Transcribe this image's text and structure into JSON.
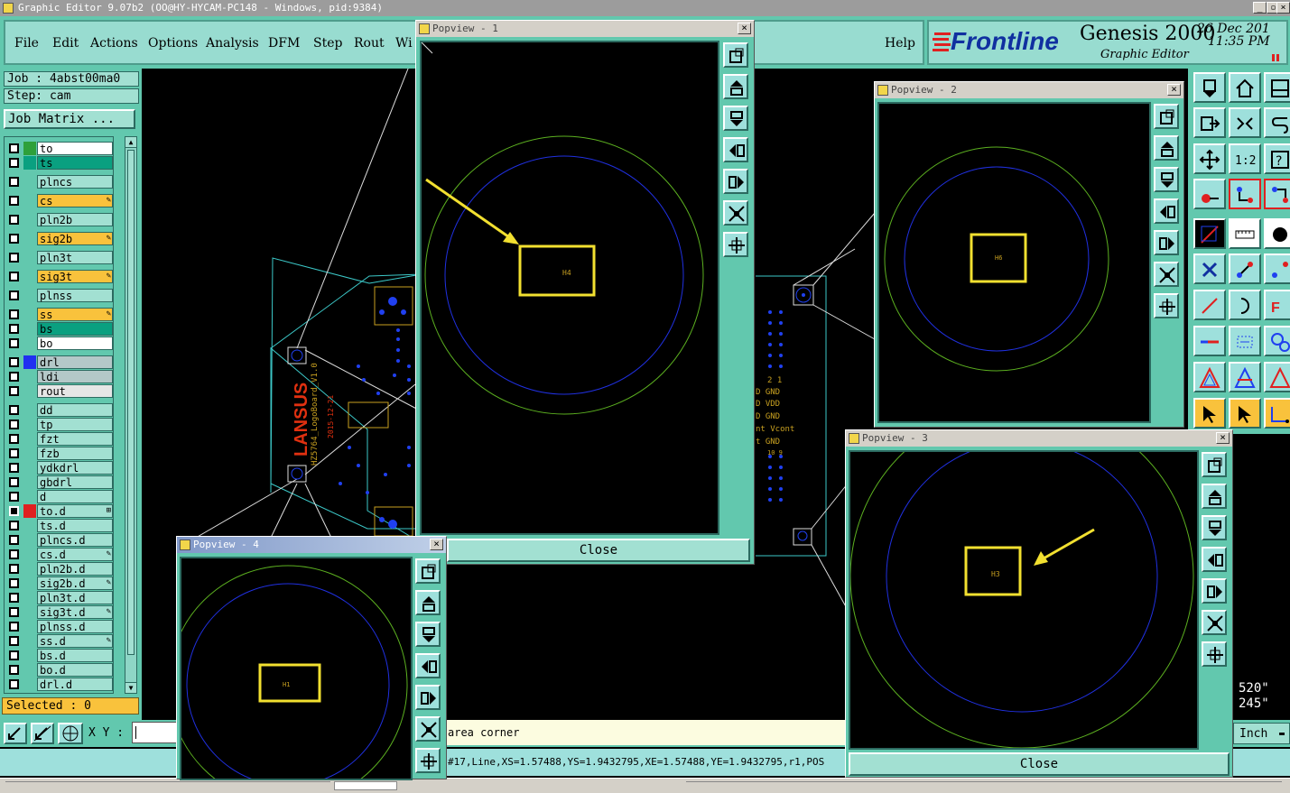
{
  "window": {
    "title": "Graphic Editor 9.07b2 (OO@HY-HYCAM-PC148 - Windows, pid:9384)"
  },
  "menu": {
    "items": [
      "File",
      "Edit",
      "Actions",
      "Options",
      "Analysis",
      "DFM",
      "Step",
      "Rout",
      "Wi"
    ],
    "help": "Help"
  },
  "brand": {
    "logo": "Frontline",
    "product": "Genesis 2000",
    "subtitle": "Graphic Editor",
    "date": "26 Dec 201",
    "time": "11:35 PM"
  },
  "job": {
    "job_label": "Job : 4abst00ma0",
    "step_label": "Step: cam",
    "matrix_button": "Job Matrix ..."
  },
  "layers": [
    {
      "name": "to",
      "bg": "#ffffff",
      "swatch": "#2ea03a"
    },
    {
      "name": "ts",
      "bg": "#0aa080",
      "swatch": "#0aa080"
    },
    {
      "name": "plncs",
      "bg": "#a2e0d2"
    },
    {
      "name": "cs",
      "bg": "#f9c23c",
      "edit": true
    },
    {
      "name": "pln2b",
      "bg": "#a2e0d2"
    },
    {
      "name": "sig2b",
      "bg": "#f9c23c",
      "edit": true
    },
    {
      "name": "pln3t",
      "bg": "#a2e0d2"
    },
    {
      "name": "sig3t",
      "bg": "#f9c23c",
      "edit": true
    },
    {
      "name": "plnss",
      "bg": "#a2e0d2"
    },
    {
      "name": "ss",
      "bg": "#f9c23c",
      "edit": true
    },
    {
      "name": "bs",
      "bg": "#0aa080"
    },
    {
      "name": "bo",
      "bg": "#ffffff"
    },
    {
      "name": "drl",
      "bg": "#b4c8c8",
      "swatch": "#2030f0"
    },
    {
      "name": "ldi",
      "bg": "#b4c8c8"
    },
    {
      "name": "rout",
      "bg": "#e6e6e6"
    },
    {
      "name": "dd",
      "bg": "#a2e0d2"
    },
    {
      "name": "tp",
      "bg": "#a2e0d2"
    },
    {
      "name": "fzt",
      "bg": "#a2e0d2"
    },
    {
      "name": "fzb",
      "bg": "#a2e0d2"
    },
    {
      "name": "ydkdrl",
      "bg": "#a2e0d2"
    },
    {
      "name": "gbdrl",
      "bg": "#a2e0d2"
    },
    {
      "name": "d",
      "bg": "#a2e0d2"
    },
    {
      "name": "to.d",
      "bg": "#a2e0d2",
      "swatch": "#e02020",
      "active": true,
      "grid": true
    },
    {
      "name": "ts.d",
      "bg": "#a2e0d2"
    },
    {
      "name": "plncs.d",
      "bg": "#a2e0d2"
    },
    {
      "name": "cs.d",
      "bg": "#a2e0d2",
      "edit": true
    },
    {
      "name": "pln2b.d",
      "bg": "#a2e0d2"
    },
    {
      "name": "sig2b.d",
      "bg": "#a2e0d2",
      "edit": true
    },
    {
      "name": "pln3t.d",
      "bg": "#a2e0d2"
    },
    {
      "name": "sig3t.d",
      "bg": "#a2e0d2",
      "edit": true
    },
    {
      "name": "plnss.d",
      "bg": "#a2e0d2"
    },
    {
      "name": "ss.d",
      "bg": "#a2e0d2",
      "edit": true
    },
    {
      "name": "bs.d",
      "bg": "#a2e0d2"
    },
    {
      "name": "bo.d",
      "bg": "#a2e0d2"
    },
    {
      "name": "drl.d",
      "bg": "#a2e0d2"
    }
  ],
  "selected": "Selected : 0",
  "bottom": {
    "xy_label": "X Y :",
    "message": "area corner",
    "status": "#17,Line,XS=1.57488,YS=1.9432795,XE=1.57488,YE=1.9432795,r1,POS",
    "units": "Inch",
    "coord1": "520\"",
    "coord2": "245\""
  },
  "board": {
    "brand": "LANSUS",
    "board_name": "HZ5764_LogoBoard_V1.0",
    "board_date": "2015-12-21",
    "header_cols": "2   1",
    "pins": [
      "D   GND",
      "D   VDD",
      "D   GND",
      "nt  Vcont",
      "t   GND",
      "10  9"
    ]
  },
  "popups": [
    {
      "id": "1",
      "title": "Popview - 1",
      "label": "H4",
      "close": "Close"
    },
    {
      "id": "2",
      "title": "Popview - 2",
      "label": "H6"
    },
    {
      "id": "3",
      "title": "Popview - 3",
      "label": "H3",
      "close": "Close"
    },
    {
      "id": "4",
      "title": "Popview - 4",
      "label": "H1"
    }
  ]
}
